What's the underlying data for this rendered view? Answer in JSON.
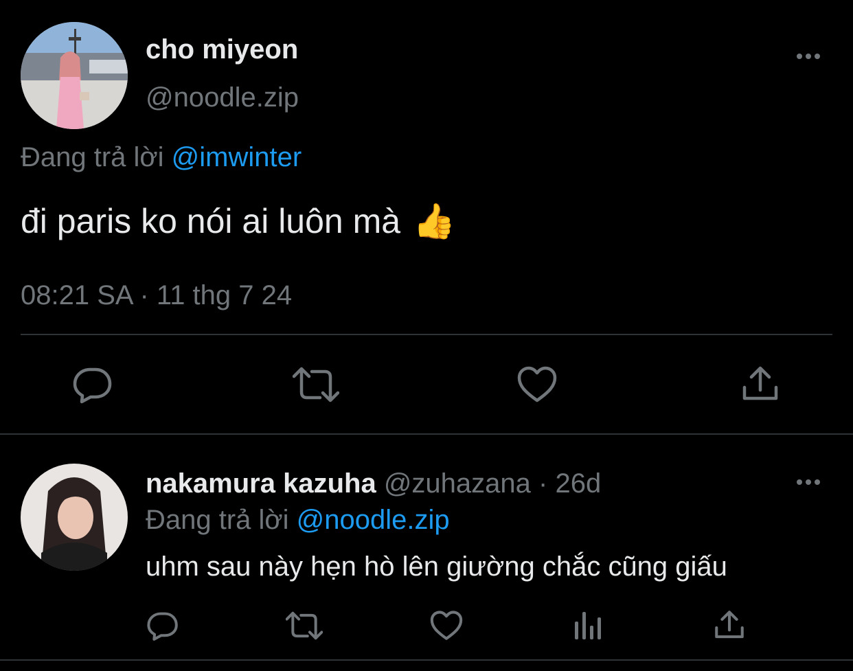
{
  "main_tweet": {
    "display_name": "cho miyeon",
    "handle": "@noodle.zip",
    "replying_prefix": "Đang trả lời",
    "replying_to": "@imwinter",
    "text": "đi paris ko nói ai luôn mà",
    "emoji": "👍",
    "timestamp": "08:21 SA · 11 thg 7 24",
    "actions": [
      "reply-icon",
      "retweet-icon",
      "like-icon",
      "share-icon"
    ]
  },
  "reply_tweet": {
    "display_name": "nakamura kazuha",
    "handle_time": "@zuhazana · 26d",
    "replying_prefix": "Đang trả lời",
    "replying_to": "@noodle.zip",
    "text": "uhm sau này hẹn hò lên giường chắc cũng giấu",
    "actions": [
      "reply-icon",
      "retweet-icon",
      "like-icon",
      "views-icon",
      "share-icon"
    ]
  },
  "colors": {
    "background": "#000000",
    "primary_text": "#e7e9ea",
    "secondary_text": "#71767b",
    "accent": "#1d9bf0",
    "divider": "#2f3336"
  }
}
